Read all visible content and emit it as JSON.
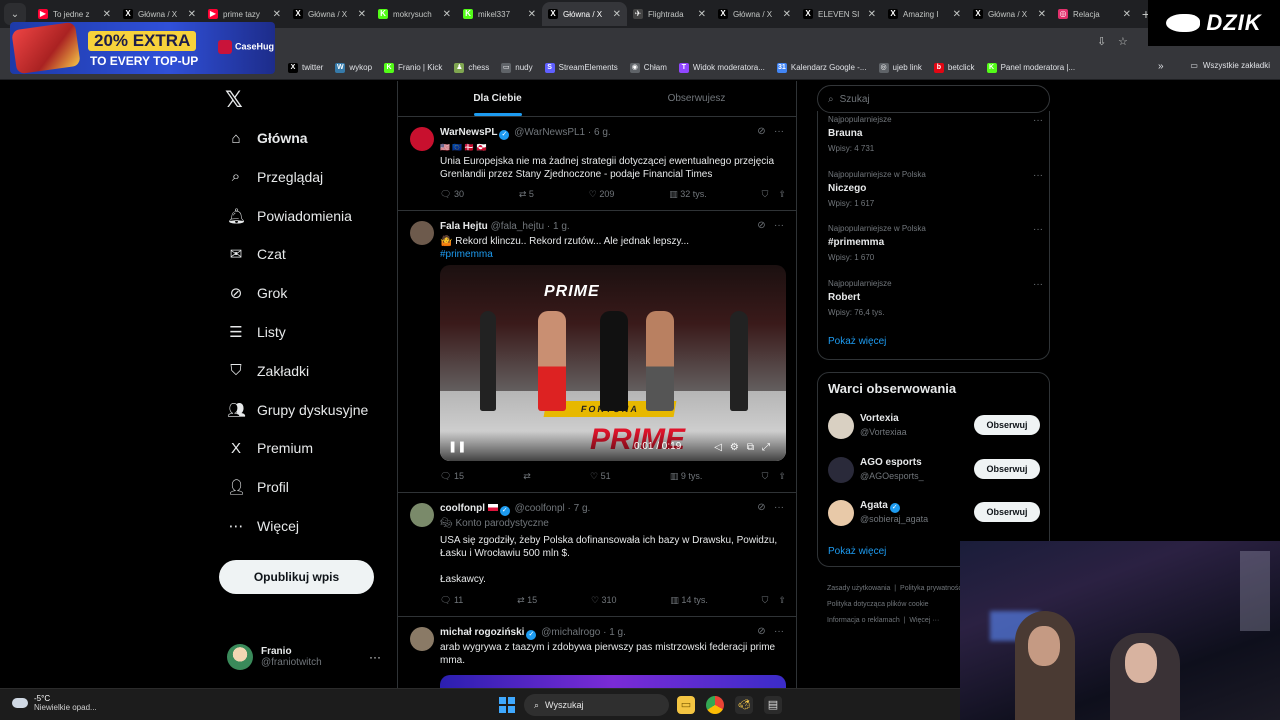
{
  "browser": {
    "tabs": [
      {
        "title": "To jedne z",
        "fav_color": "#ff0033",
        "fav": "▶",
        "active": false
      },
      {
        "title": "Główna / X",
        "fav_color": "#000000",
        "fav": "X",
        "active": false
      },
      {
        "title": "prime tazy",
        "fav_color": "#ff0033",
        "fav": "▶",
        "active": false
      },
      {
        "title": "Główna / X",
        "fav_color": "#000000",
        "fav": "X",
        "active": false
      },
      {
        "title": "mokrysuch",
        "fav_color": "#53fc18",
        "fav": "K",
        "active": false
      },
      {
        "title": "mikel337",
        "fav_color": "#53fc18",
        "fav": "K",
        "active": false
      },
      {
        "title": "Główna / X",
        "fav_color": "#000000",
        "fav": "X",
        "active": true
      },
      {
        "title": "Flightrada",
        "fav_color": "#444444",
        "fav": "✈",
        "active": false
      },
      {
        "title": "Główna / X",
        "fav_color": "#000000",
        "fav": "X",
        "active": false
      },
      {
        "title": "ELEVEN SI",
        "fav_color": "#000000",
        "fav": "X",
        "active": false
      },
      {
        "title": "Amazing I",
        "fav_color": "#000000",
        "fav": "X",
        "active": false
      },
      {
        "title": "Główna / X",
        "fav_color": "#000000",
        "fav": "X",
        "active": false
      },
      {
        "title": "Relacja",
        "fav_color": "#e1306c",
        "fav": "◎",
        "active": false
      }
    ],
    "bookmarks": [
      {
        "label": "twitter",
        "icon": "X",
        "color": "#000000"
      },
      {
        "label": "wykop",
        "icon": "W",
        "color": "#367aa9"
      },
      {
        "label": "Franio | Kick",
        "icon": "K",
        "color": "#53fc18"
      },
      {
        "label": "chess",
        "icon": "♟",
        "color": "#7fa650"
      },
      {
        "label": "nudy",
        "icon": "▭",
        "color": "#5f6368"
      },
      {
        "label": "StreamElements",
        "icon": "S",
        "color": "#5f5fff"
      },
      {
        "label": "Chłam",
        "icon": "◉",
        "color": "#5f6368"
      },
      {
        "label": "Widok moderatora...",
        "icon": "T",
        "color": "#9146ff"
      },
      {
        "label": "Kalendarz Google -...",
        "icon": "31",
        "color": "#4285f4"
      },
      {
        "label": "ujeb link",
        "icon": "◎",
        "color": "#5f6368"
      },
      {
        "label": "betclick",
        "icon": "b",
        "color": "#e30613"
      },
      {
        "label": "Panel moderatora |...",
        "icon": "K",
        "color": "#53fc18"
      }
    ],
    "all_bookmarks": "Wszystkie zakładki",
    "overflow": "»"
  },
  "promo": {
    "offer": "20% EXTRA",
    "sub": "TO EVERY TOP-UP",
    "brand": "CaseHug"
  },
  "stream_logo": "DZIK",
  "nav": {
    "items": [
      {
        "label": "Główna",
        "icon": "⌂",
        "bold": true
      },
      {
        "label": "Przeglądaj",
        "icon": "⌕",
        "bold": false
      },
      {
        "label": "Powiadomienia",
        "icon": "🔔︎",
        "bold": false
      },
      {
        "label": "Czat",
        "icon": "✉",
        "bold": false
      },
      {
        "label": "Grok",
        "icon": "⊘",
        "bold": false
      },
      {
        "label": "Listy",
        "icon": "☰",
        "bold": false
      },
      {
        "label": "Zakładki",
        "icon": "⛉",
        "bold": false
      },
      {
        "label": "Grupy dyskusyjne",
        "icon": "👥︎",
        "bold": false
      },
      {
        "label": "Premium",
        "icon": "X",
        "bold": false
      },
      {
        "label": "Profil",
        "icon": "👤︎",
        "bold": false
      },
      {
        "label": "Więcej",
        "icon": "⋯",
        "bold": false
      }
    ],
    "post_button": "Opublikuj wpis",
    "user": {
      "name": "Franio",
      "handle": "@franiotwitch"
    }
  },
  "timeline": {
    "tabs": [
      "Dla Ciebie",
      "Obserwujesz"
    ],
    "tweets": [
      {
        "name": "WarNewsPL",
        "handle": "@WarNewsPL1",
        "time": "· 6 g.",
        "verified": true,
        "flags": "🇺🇸 🇪🇺 🇩🇰 🇬🇱",
        "text": "Unia Europejska nie ma żadnej strategii dotyczącej ewentualnego przejęcia Grenlandii przez Stany Zjednoczone - podaje Financial Times",
        "replies": "30",
        "reposts": "5",
        "likes": "209",
        "views": "32 tys."
      },
      {
        "name": "Fala Hejtu",
        "handle": "@fala_hejtu",
        "time": "· 1 g.",
        "verified": false,
        "text": "🤷 Rekord klinczu.. Rekord rzutów... Ale jednak lepszy...",
        "hashtag": "#primemma",
        "video_time": "0:01 / 0:19",
        "replies": "15",
        "reposts": "",
        "likes": "51",
        "views": "9 tys."
      },
      {
        "name": "coolfonpl",
        "handle": "@coolfonpl",
        "time": "· 7 g.",
        "verified": true,
        "parody": "Konto parodystyczne",
        "text": "USA się zgodziły, żeby Polska dofinansowała ich bazy w Drawsku, Powidzu, Łasku i Wrocławiu 500 mln $.",
        "text2": "Łaskawcy.",
        "replies": "11",
        "reposts": "15",
        "likes": "310",
        "views": "14 tys."
      },
      {
        "name": "michał rogoziński",
        "handle": "@michalrogo",
        "time": "· 1 g.",
        "verified": true,
        "text": "arab wygrywa z taazym i zdobywa pierwszy pas mistrzowski federacji prime mma."
      }
    ]
  },
  "right": {
    "search_placeholder": "Szukaj",
    "trends": [
      {
        "context": "Najpopularniejsze",
        "name": "Brauna",
        "count": "Wpisy: 4 731"
      },
      {
        "context": "Najpopularniejsze w Polska",
        "name": "Niczego",
        "count": "Wpisy: 1 617"
      },
      {
        "context": "Najpopularniejsze w Polska",
        "name": "#primemma",
        "count": "Wpisy: 1 670"
      },
      {
        "context": "Najpopularniejsze",
        "name": "Robert",
        "count": "Wpisy: 76,4 tys."
      }
    ],
    "show_more": "Pokaż więcej",
    "who_to_follow": {
      "title": "Warci obserwowania",
      "accounts": [
        {
          "name": "Vortexia",
          "handle": "@Vortexiaa",
          "verified": false
        },
        {
          "name": "AGO esports",
          "handle": "@AGOesports_",
          "verified": false
        },
        {
          "name": "Agata",
          "handle": "@sobieraj_agata",
          "verified": true
        }
      ],
      "follow_label": "Obserwuj",
      "show_more": "Pokaż więcej"
    },
    "footer": [
      "Zasady użytkowania",
      "Polityka prywatności",
      "Polityka dotycząca plików cookie",
      "Informacja o reklamach",
      "Więcej ···"
    ]
  },
  "taskbar": {
    "temp": "-5°C",
    "weather": "Niewielkie opad...",
    "search": "Wyszukaj"
  }
}
